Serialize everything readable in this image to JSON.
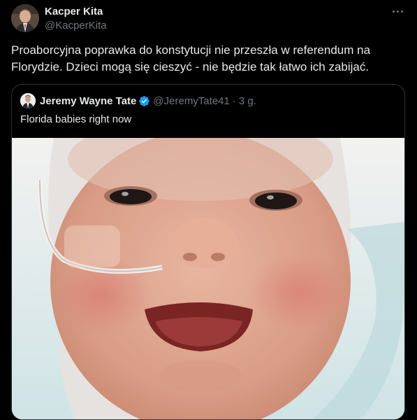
{
  "author": {
    "name": "Kacper Kita",
    "handle": "@KacperKita"
  },
  "tweet": {
    "text": "Proaborcyjna poprawka do konstytucji nie przeszła w referendum na Florydzie. Dzieci mogą się cieszyć - nie będzie tak łatwo ich zabijać."
  },
  "quoted": {
    "name": "Jeremy Wayne Tate",
    "handle": "@JeremyTate41",
    "separator": "·",
    "time": "3 g.",
    "text": "Florida babies right now",
    "verified": true
  },
  "icons": {
    "more": "more-options-icon",
    "verified": "verified-badge-icon"
  },
  "colors": {
    "background": "#000000",
    "text": "#e7e9ea",
    "secondary": "#71767b",
    "border": "#2f3336",
    "verified": "#1d9bf0"
  }
}
